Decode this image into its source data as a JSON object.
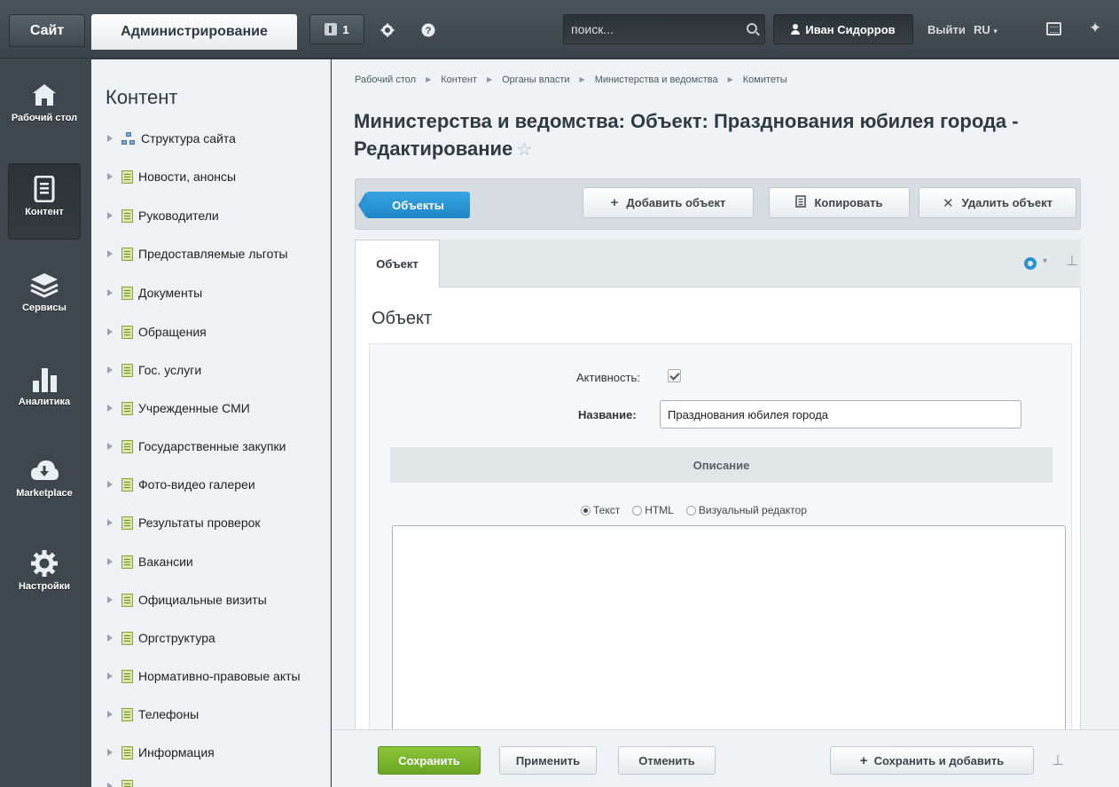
{
  "topbar": {
    "site_label": "Сайт",
    "admin_label": "Администрирование",
    "notif_count": "1",
    "search_placeholder": "поиск...",
    "user_name": "Иван Сидорров",
    "logout_label": "Выйти",
    "lang_label": "RU",
    "settings_icon": "gear-icon",
    "help_icon": "help-icon"
  },
  "leftnav": [
    {
      "label": "Рабочий стол",
      "icon": "home-icon"
    },
    {
      "label": "Контент",
      "icon": "document-icon",
      "active": true
    },
    {
      "label": "Сервисы",
      "icon": "layers-icon"
    },
    {
      "label": "Аналитика",
      "icon": "bar-chart-icon"
    },
    {
      "label": "Marketplace",
      "icon": "cloud-download-icon"
    },
    {
      "label": "Настройки",
      "icon": "gear-icon"
    }
  ],
  "tree": {
    "title": "Контент",
    "items": [
      "Структура сайта",
      "Новости, анонсы",
      "Руководители",
      "Предоставляемые льготы",
      "Документы",
      "Обращения",
      "Гос. услуги",
      "Учрежденные СМИ",
      "Государственные закупки",
      "Фото-видео галереи",
      "Результаты проверок",
      "Вакансии",
      "Официальные визиты",
      "Оргструктура",
      "Нормативно-правовые акты",
      "Телефоны",
      "Информация"
    ]
  },
  "breadcrumb": [
    "Рабочий стол",
    "Контент",
    "Органы власти",
    "Министерства и ведомства",
    "Комитеты"
  ],
  "page": {
    "title": "Министерства и ведомства: Объект: Празднования юбилея города - Редактирование"
  },
  "toolbar": {
    "objects_label": "Объекты",
    "add_label": "Добавить объект",
    "copy_label": "Копировать",
    "delete_label": "Удалить объект"
  },
  "tabs": {
    "object_tab": "Объект"
  },
  "form": {
    "panel_title": "Объект",
    "active_label": "Активность:",
    "active_checked": true,
    "name_label": "Название:",
    "name_value": "Празднования юбилея города",
    "description_header": "Описание",
    "radio_text": "Текст",
    "radio_html": "HTML",
    "radio_visual": "Визуальный редактор",
    "selected_mode": "Текст"
  },
  "footer": {
    "save_label": "Сохранить",
    "apply_label": "Применить",
    "cancel_label": "Отменить",
    "save_add_label": "Сохранить и добавить"
  },
  "colors": {
    "accent_blue": "#1f87c8",
    "save_green": "#6aa623",
    "dark_bg": "#3e474d"
  }
}
